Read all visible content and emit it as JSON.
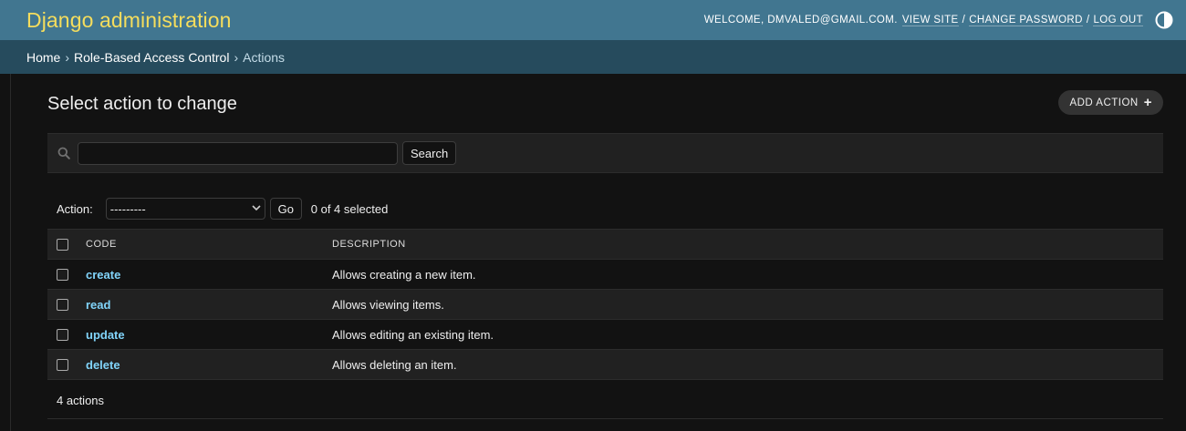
{
  "header": {
    "site_name": "Django administration",
    "welcome": "Welcome, dmvaled@gmail.com.",
    "view_site": "View site",
    "change_password": "Change password",
    "log_out": "Log out",
    "sep": "/",
    "theme_icon": "half-circle-icon"
  },
  "breadcrumbs": {
    "home": "Home",
    "app": "Role-Based Access Control",
    "current": "Actions",
    "separator": "›"
  },
  "main": {
    "title": "Select action to change",
    "add_button": "Add action",
    "add_icon": "plus-icon"
  },
  "search": {
    "icon": "search-icon",
    "value": "",
    "placeholder": "",
    "button": "Search"
  },
  "actions": {
    "label": "Action:",
    "selected_option": "---------",
    "go_button": "Go",
    "selected_count": "0 of 4 selected"
  },
  "table": {
    "columns": [
      "Code",
      "Description"
    ],
    "rows": [
      {
        "code": "create",
        "description": "Allows creating a new item."
      },
      {
        "code": "read",
        "description": "Allows viewing items."
      },
      {
        "code": "update",
        "description": "Allows editing an existing item."
      },
      {
        "code": "delete",
        "description": "Allows deleting an item."
      }
    ]
  },
  "paginator": {
    "text": "4 actions"
  },
  "colors": {
    "header_bg": "#417690",
    "breadcrumb_bg": "#264b5d",
    "brand_yellow": "#f5dd5d",
    "link_blue": "#81d4fa",
    "page_bg": "#121212"
  }
}
